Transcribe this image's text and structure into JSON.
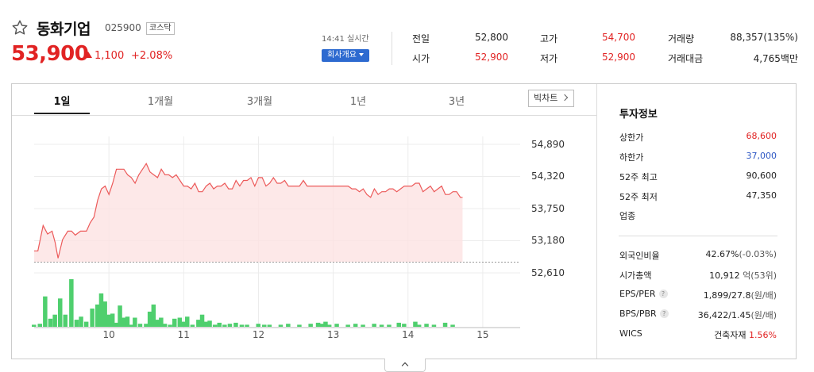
{
  "stock": {
    "name": "동화기업",
    "code": "025900",
    "market": "코스닥",
    "price": "53,900",
    "change": "1,100",
    "change_pct": "+2.08%",
    "status_time": "14:41 실시간",
    "company_btn": "회사개요"
  },
  "quote": {
    "prev_label": "전일",
    "prev": "52,800",
    "high_label": "고가",
    "high": "54,700",
    "volume_label": "거래량",
    "volume": "88,357(135%)",
    "open_label": "시가",
    "open": "52,900",
    "low_label": "저가",
    "low": "52,900",
    "amount_label": "거래대금",
    "amount": "4,765백만"
  },
  "tabs": [
    "1일",
    "1개월",
    "3개월",
    "1년",
    "3년"
  ],
  "big_chart_btn": "빅차트",
  "info": {
    "title": "투자정보",
    "upper_label": "상한가",
    "upper": "68,600",
    "lower_label": "하한가",
    "lower": "37,000",
    "high52_label": "52주 최고",
    "high52": "90,600",
    "low52_label": "52주 최저",
    "low52": "47,350",
    "sector_label": "업종",
    "foreign_label": "외국인비율",
    "foreign": "42.67%",
    "foreign_chg": "(-0.03%)",
    "cap_label": "시가총액",
    "cap": "10,912",
    "cap_unit": "억(53위)",
    "eps_label": "EPS/PER",
    "eps": "1,899/27.8",
    "eps_unit": "(원/배)",
    "bps_label": "BPS/PBR",
    "bps": "36,422/1.45",
    "bps_unit": "(원/배)",
    "wics_label": "WICS",
    "wics": "건축자재",
    "wics_pct": "1.56%",
    "help_mark": "?"
  },
  "colors": {
    "up": "#e12323",
    "down": "#2d57c4",
    "volume": "#4fcf6e",
    "line": "#ec5a5a",
    "fill": "#fde2e2",
    "accent": "#2d6ad0"
  },
  "chart_data": {
    "type": "line",
    "ylim": [
      52610,
      54890
    ],
    "yticks": [
      "54,890",
      "54,320",
      "53,750",
      "53,180",
      "52,610"
    ],
    "x_ticks": [
      "10",
      "11",
      "12",
      "13",
      "14",
      "15"
    ],
    "x_tick_times": [
      10,
      11,
      12,
      13,
      14,
      15
    ],
    "xlim": [
      9.0,
      15.5
    ],
    "baseline": 52800,
    "price": [
      [
        9.0,
        53000
      ],
      [
        9.05,
        53000
      ],
      [
        9.12,
        53450
      ],
      [
        9.18,
        53300
      ],
      [
        9.24,
        53350
      ],
      [
        9.28,
        53150
      ],
      [
        9.32,
        52870
      ],
      [
        9.38,
        53200
      ],
      [
        9.45,
        53350
      ],
      [
        9.5,
        53350
      ],
      [
        9.55,
        53280
      ],
      [
        9.62,
        53350
      ],
      [
        9.7,
        53350
      ],
      [
        9.75,
        53500
      ],
      [
        9.8,
        53600
      ],
      [
        9.85,
        53900
      ],
      [
        9.9,
        54100
      ],
      [
        9.95,
        54150
      ],
      [
        10.0,
        54000
      ],
      [
        10.05,
        54200
      ],
      [
        10.1,
        54450
      ],
      [
        10.2,
        54450
      ],
      [
        10.25,
        54350
      ],
      [
        10.3,
        54300
      ],
      [
        10.35,
        54200
      ],
      [
        10.4,
        54350
      ],
      [
        10.45,
        54450
      ],
      [
        10.5,
        54550
      ],
      [
        10.55,
        54400
      ],
      [
        10.6,
        54350
      ],
      [
        10.65,
        54300
      ],
      [
        10.7,
        54450
      ],
      [
        10.75,
        54350
      ],
      [
        10.8,
        54350
      ],
      [
        10.85,
        54300
      ],
      [
        10.9,
        54350
      ],
      [
        10.95,
        54250
      ],
      [
        11.0,
        54150
      ],
      [
        11.05,
        54150
      ],
      [
        11.1,
        54100
      ],
      [
        11.15,
        54200
      ],
      [
        11.2,
        54050
      ],
      [
        11.25,
        54050
      ],
      [
        11.3,
        54150
      ],
      [
        11.35,
        54200
      ],
      [
        11.4,
        54100
      ],
      [
        11.45,
        54150
      ],
      [
        11.5,
        54150
      ],
      [
        11.55,
        54200
      ],
      [
        11.6,
        54100
      ],
      [
        11.65,
        54100
      ],
      [
        11.7,
        54250
      ],
      [
        11.75,
        54150
      ],
      [
        11.8,
        54250
      ],
      [
        11.85,
        54250
      ],
      [
        11.9,
        54300
      ],
      [
        11.95,
        54150
      ],
      [
        12.0,
        54300
      ],
      [
        12.05,
        54300
      ],
      [
        12.1,
        54150
      ],
      [
        12.15,
        54200
      ],
      [
        12.2,
        54300
      ],
      [
        12.25,
        54200
      ],
      [
        12.3,
        54200
      ],
      [
        12.35,
        54250
      ],
      [
        12.4,
        54150
      ],
      [
        12.45,
        54150
      ],
      [
        12.5,
        54150
      ],
      [
        12.55,
        54150
      ],
      [
        12.6,
        54250
      ],
      [
        12.65,
        54150
      ],
      [
        12.7,
        54150
      ],
      [
        12.75,
        54150
      ],
      [
        12.8,
        54150
      ],
      [
        12.85,
        54150
      ],
      [
        12.9,
        54150
      ],
      [
        12.95,
        54150
      ],
      [
        13.0,
        54150
      ],
      [
        13.1,
        54150
      ],
      [
        13.2,
        54150
      ],
      [
        13.25,
        54100
      ],
      [
        13.3,
        54100
      ],
      [
        13.35,
        54050
      ],
      [
        13.4,
        54100
      ],
      [
        13.45,
        54000
      ],
      [
        13.5,
        53950
      ],
      [
        13.55,
        54100
      ],
      [
        13.6,
        54000
      ],
      [
        13.65,
        54050
      ],
      [
        13.7,
        54050
      ],
      [
        13.75,
        54100
      ],
      [
        13.8,
        54100
      ],
      [
        13.85,
        54050
      ],
      [
        13.9,
        54100
      ],
      [
        13.95,
        54150
      ],
      [
        14.0,
        54150
      ],
      [
        14.05,
        54150
      ],
      [
        14.1,
        54200
      ],
      [
        14.15,
        54200
      ],
      [
        14.2,
        54050
      ],
      [
        14.25,
        54100
      ],
      [
        14.3,
        54150
      ],
      [
        14.35,
        54050
      ],
      [
        14.4,
        54100
      ],
      [
        14.45,
        54150
      ],
      [
        14.5,
        54000
      ],
      [
        14.55,
        54000
      ],
      [
        14.6,
        54050
      ],
      [
        14.65,
        54050
      ],
      [
        14.7,
        53950
      ],
      [
        14.73,
        53950
      ]
    ],
    "volume": [
      [
        9.0,
        2
      ],
      [
        9.08,
        3
      ],
      [
        9.15,
        30
      ],
      [
        9.22,
        8
      ],
      [
        9.28,
        12
      ],
      [
        9.35,
        28
      ],
      [
        9.42,
        12
      ],
      [
        9.5,
        47
      ],
      [
        9.57,
        7
      ],
      [
        9.63,
        10
      ],
      [
        9.7,
        5
      ],
      [
        9.78,
        18
      ],
      [
        9.85,
        22
      ],
      [
        9.9,
        33
      ],
      [
        9.95,
        25
      ],
      [
        10.0,
        12
      ],
      [
        10.05,
        13
      ],
      [
        10.1,
        4
      ],
      [
        10.15,
        21
      ],
      [
        10.2,
        9
      ],
      [
        10.25,
        10
      ],
      [
        10.3,
        2
      ],
      [
        10.35,
        9
      ],
      [
        10.42,
        3
      ],
      [
        10.5,
        3
      ],
      [
        10.55,
        15
      ],
      [
        10.6,
        22
      ],
      [
        10.65,
        7
      ],
      [
        10.7,
        9
      ],
      [
        10.75,
        3
      ],
      [
        10.82,
        2
      ],
      [
        10.88,
        8
      ],
      [
        10.95,
        9
      ],
      [
        11.0,
        5
      ],
      [
        11.05,
        10
      ],
      [
        11.12,
        2
      ],
      [
        11.2,
        7
      ],
      [
        11.25,
        12
      ],
      [
        11.3,
        5
      ],
      [
        11.35,
        6
      ],
      [
        11.42,
        2
      ],
      [
        11.48,
        4
      ],
      [
        11.55,
        2
      ],
      [
        11.62,
        3
      ],
      [
        11.7,
        4
      ],
      [
        11.78,
        2
      ],
      [
        11.85,
        2
      ],
      [
        12.0,
        3
      ],
      [
        12.08,
        2
      ],
      [
        12.15,
        2
      ],
      [
        12.3,
        2
      ],
      [
        12.4,
        3
      ],
      [
        12.55,
        2
      ],
      [
        12.7,
        3
      ],
      [
        12.8,
        4
      ],
      [
        12.85,
        3
      ],
      [
        12.9,
        5
      ],
      [
        12.95,
        2
      ],
      [
        13.05,
        3
      ],
      [
        13.2,
        2
      ],
      [
        13.3,
        3
      ],
      [
        13.4,
        2
      ],
      [
        13.55,
        3
      ],
      [
        13.65,
        2
      ],
      [
        13.75,
        2
      ],
      [
        13.88,
        4
      ],
      [
        13.95,
        3
      ],
      [
        14.1,
        5
      ],
      [
        14.15,
        2
      ],
      [
        14.25,
        3
      ],
      [
        14.35,
        2
      ],
      [
        14.5,
        4
      ],
      [
        14.6,
        2
      ]
    ]
  }
}
